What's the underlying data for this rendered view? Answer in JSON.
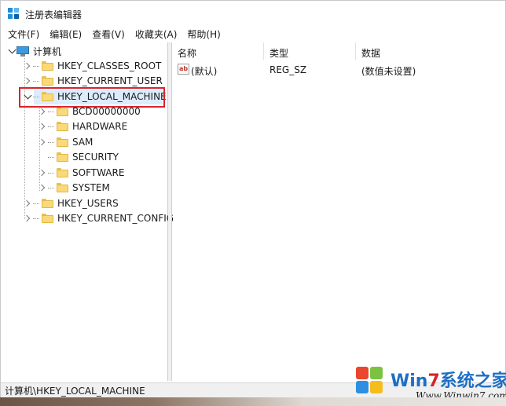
{
  "window": {
    "title": "注册表编辑器"
  },
  "menu": [
    "文件(F)",
    "编辑(E)",
    "查看(V)",
    "收藏夹(A)",
    "帮助(H)"
  ],
  "tree": {
    "root": "计算机",
    "hives": [
      "HKEY_CLASSES_ROOT",
      "HKEY_CURRENT_USER",
      "HKEY_LOCAL_MACHINE",
      "HKEY_USERS",
      "HKEY_CURRENT_CONFIG"
    ],
    "local_machine_children": [
      "BCD00000000",
      "HARDWARE",
      "SAM",
      "SECURITY",
      "SOFTWARE",
      "SYSTEM"
    ]
  },
  "list": {
    "columns": [
      "名称",
      "类型",
      "数据"
    ],
    "rows": [
      {
        "name": "(默认)",
        "type": "REG_SZ",
        "data": "(数值未设置)",
        "icon": "ab-string-icon"
      }
    ]
  },
  "status": {
    "path": "计算机\\HKEY_LOCAL_MACHINE"
  },
  "watermark": {
    "brand_pre": "Win",
    "brand_seven": "7",
    "brand_post": "系统之家",
    "url": "Www.Winwin7.com"
  },
  "colors": {
    "highlight_box": "#d9232b",
    "selection": "#dcecfc",
    "folder": "#f9d978"
  }
}
